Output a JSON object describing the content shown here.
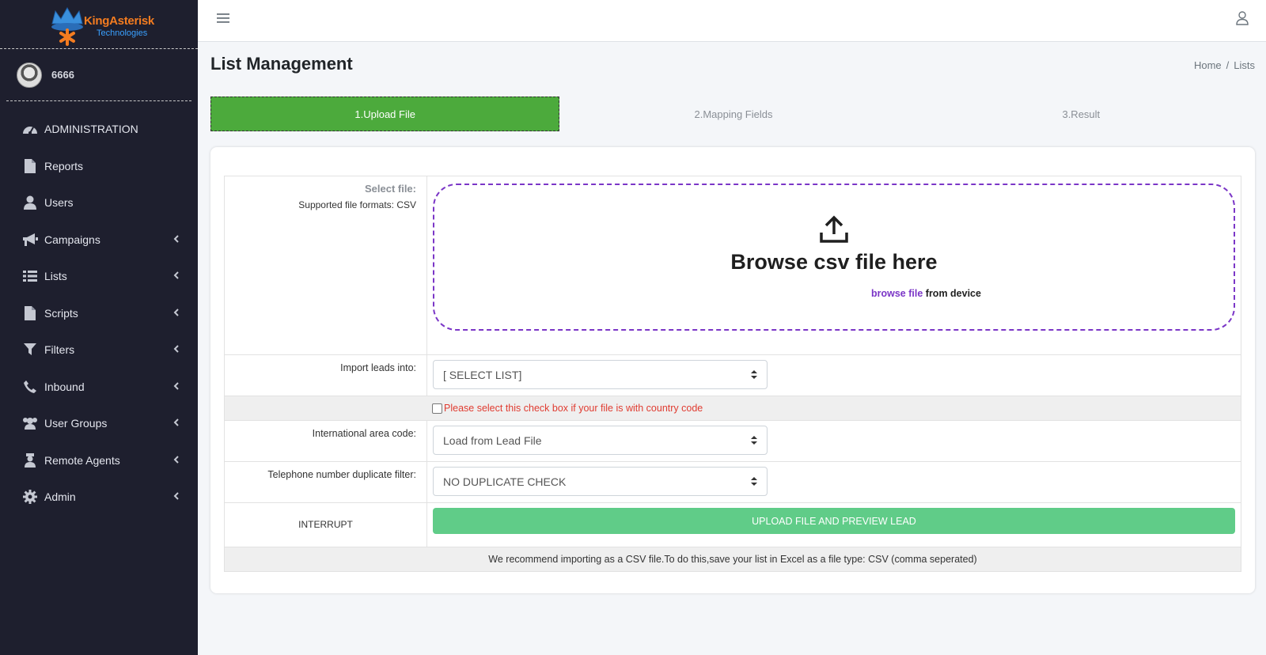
{
  "brand": {
    "name": "KingAsterisk",
    "sub": "Technologies"
  },
  "user": {
    "name": "6666"
  },
  "sidebar": {
    "items": [
      {
        "label": "ADMINISTRATION",
        "icon": "dashboard-icon"
      },
      {
        "label": "Reports",
        "icon": "file-icon"
      },
      {
        "label": "Users",
        "icon": "user-icon"
      },
      {
        "label": "Campaigns",
        "icon": "megaphone-icon"
      },
      {
        "label": "Lists",
        "icon": "list-icon"
      },
      {
        "label": "Scripts",
        "icon": "file-icon"
      },
      {
        "label": "Filters",
        "icon": "filter-icon"
      },
      {
        "label": "Inbound",
        "icon": "phone-icon"
      },
      {
        "label": "User Groups",
        "icon": "users-icon"
      },
      {
        "label": "Remote Agents",
        "icon": "agent-icon"
      },
      {
        "label": "Admin",
        "icon": "gear-icon"
      }
    ]
  },
  "page": {
    "title": "List Management"
  },
  "breadcrumb": {
    "home": "Home",
    "sep": "/",
    "current": "Lists"
  },
  "steps": [
    "1.Upload File",
    "2.Mapping Fields",
    "3.Result"
  ],
  "form": {
    "select_file_label": "Select file:",
    "supported_formats": "Supported file formats: CSV",
    "drop_title": "Browse csv file here",
    "drop_link": "browse file",
    "drop_suffix": "from device",
    "import_label": "Import leads into:",
    "import_value": "[ SELECT LIST]",
    "country_code_label": "Please select this check box if your file is with country code",
    "area_code_label": "International area code:",
    "area_code_value": "Load from Lead File",
    "dup_label": "Telephone number duplicate filter:",
    "dup_value": "NO DUPLICATE CHECK",
    "interrupt": "INTERRUPT",
    "upload_button": "UPLOAD FILE AND PREVIEW LEAD",
    "note": "We recommend importing as a CSV file.To do this,save your list in Excel as a file type: CSV (comma seperated)"
  },
  "colors": {
    "sidebar": "#1e1f2e",
    "accent_green": "#4caa3c",
    "upload_green": "#60cc88",
    "purple": "#7b36c7",
    "danger": "#e03c31"
  }
}
